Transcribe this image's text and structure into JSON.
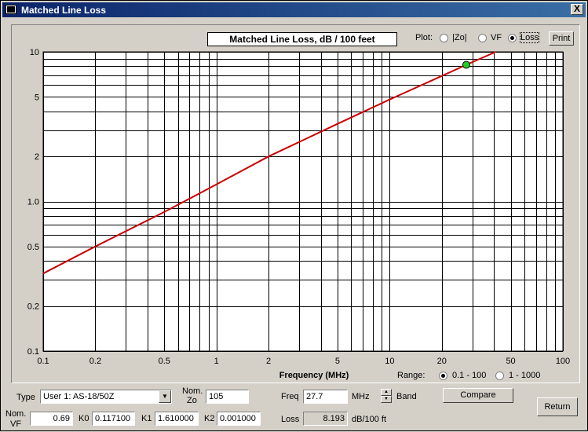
{
  "window": {
    "title": "Matched Line Loss",
    "close_label": "X"
  },
  "plot": {
    "title": "Matched Line Loss, dB / 100 feet",
    "plot_label": "Plot:",
    "options": [
      {
        "label": "|Zo|",
        "selected": false
      },
      {
        "label": "VF",
        "selected": false
      },
      {
        "label": "Loss",
        "selected": true
      }
    ],
    "print_label": "Print",
    "range_label": "Range:",
    "range_options": [
      {
        "label": "0.1 - 100",
        "selected": true
      },
      {
        "label": "1 - 1000",
        "selected": false
      }
    ]
  },
  "chart_data": {
    "type": "line",
    "title": "Matched Line Loss, dB / 100 feet",
    "xlabel": "Frequency (MHz)",
    "ylabel": "",
    "xscale": "log",
    "yscale": "log",
    "xlim": [
      0.1,
      100
    ],
    "ylim": [
      0.1,
      10
    ],
    "x_tick_labels": [
      "0.1",
      "0.2",
      "0.5",
      "1",
      "2",
      "5",
      "10",
      "20",
      "50",
      "100"
    ],
    "y_tick_labels": [
      "0.1",
      "0.2",
      "0.5",
      "1.0",
      "2",
      "5",
      "10"
    ],
    "grid": true,
    "series": [
      {
        "color": "#cc0000",
        "x": [
          0.1,
          0.2,
          0.5,
          1,
          2,
          5,
          10,
          20,
          27.7,
          41
        ],
        "y": [
          0.33,
          0.5,
          0.85,
          1.3,
          2.0,
          3.3,
          4.8,
          6.9,
          8.19,
          10
        ]
      }
    ],
    "marker": {
      "x": 27.7,
      "y": 8.193,
      "color": "#22cc22"
    }
  },
  "controls": {
    "type_label": "Type",
    "type_value": "User 1: AS-18/50Z",
    "nomzo_label_1": "Nom.",
    "nomzo_label_2": "Zo",
    "nomzo_value": "105",
    "freq_label": "Freq",
    "freq_value": "27.7",
    "freq_unit": "MHz",
    "band_label": "Band",
    "compare_label": "Compare",
    "nomvf_label_1": "Nom.",
    "nomvf_label_2": "VF",
    "nomvf_value": "0.69",
    "k0_label": "K0",
    "k0_value": "0.117100",
    "k1_label": "K1",
    "k1_value": "1.610000",
    "k2_label": "K2",
    "k2_value": "0.001000",
    "loss_label": "Loss",
    "loss_value": "8.193",
    "loss_unit": "dB/100 ft",
    "return_label": "Return"
  }
}
